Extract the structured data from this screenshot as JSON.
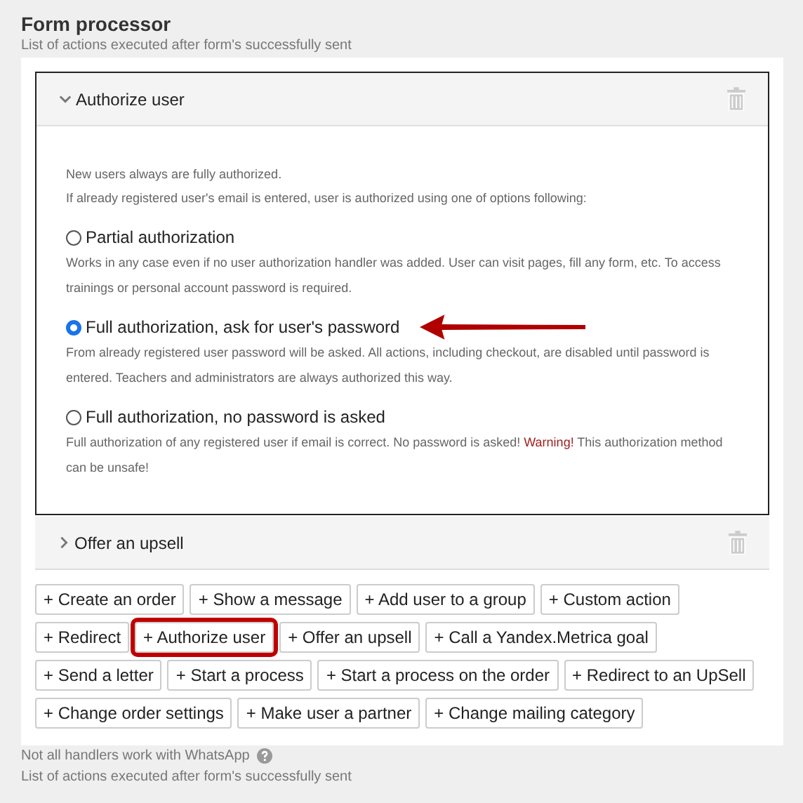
{
  "title": "Form processor",
  "subtitle": "List of actions executed after form's successfully sent",
  "handlers": [
    {
      "title": "Authorize user",
      "expanded": true,
      "intro": [
        "New users always are fully authorized.",
        "If already registered user's email is entered, user is authorized using one of options following:"
      ],
      "options": [
        {
          "label": "Partial authorization",
          "selected": false,
          "pointer_arrow": false,
          "description": [
            {
              "text": "Works in any case even if no user authorization handler was added. User can visit pages, fill any form, etc. To access trainings or personal account password is required.",
              "warning": false
            }
          ]
        },
        {
          "label": "Full authorization, ask for user's password",
          "selected": true,
          "pointer_arrow": true,
          "description": [
            {
              "text": "From already registered user password will be asked. All actions, including checkout, are disabled until password is entered. Teachers and administrators are always authorized this way.",
              "warning": false
            }
          ]
        },
        {
          "label": "Full authorization, no password is asked",
          "selected": false,
          "pointer_arrow": false,
          "description": [
            {
              "text": "Full authorization of any registered user if email is correct. No password is asked! ",
              "warning": false
            },
            {
              "text": "Warning!",
              "warning": true
            },
            {
              "text": " This authorization method can be unsafe!",
              "warning": false
            }
          ]
        }
      ]
    },
    {
      "title": "Offer an upsell",
      "expanded": false
    }
  ],
  "add_buttons": [
    {
      "label": "+ Create an order",
      "highlighted": false
    },
    {
      "label": "+ Show a message",
      "highlighted": false
    },
    {
      "label": "+ Add user to a group",
      "highlighted": false
    },
    {
      "label": "+ Custom action",
      "highlighted": false
    },
    {
      "label": "+ Redirect",
      "highlighted": false
    },
    {
      "label": "+ Authorize user",
      "highlighted": true
    },
    {
      "label": "+ Offer an upsell",
      "highlighted": false
    },
    {
      "label": "+ Call a Yandex.Metrica goal",
      "highlighted": false
    },
    {
      "label": "+ Send a letter",
      "highlighted": false
    },
    {
      "label": "+ Start a process",
      "highlighted": false
    },
    {
      "label": "+ Start a process on the order",
      "highlighted": false
    },
    {
      "label": "+ Redirect to an UpSell",
      "highlighted": false
    },
    {
      "label": "+ Change order settings",
      "highlighted": false
    },
    {
      "label": "+ Make user a partner",
      "highlighted": false
    },
    {
      "label": "+ Change mailing category",
      "highlighted": false
    }
  ],
  "note": "Not all handlers work with WhatsApp",
  "footer": "List of actions executed after form's successfully sent"
}
